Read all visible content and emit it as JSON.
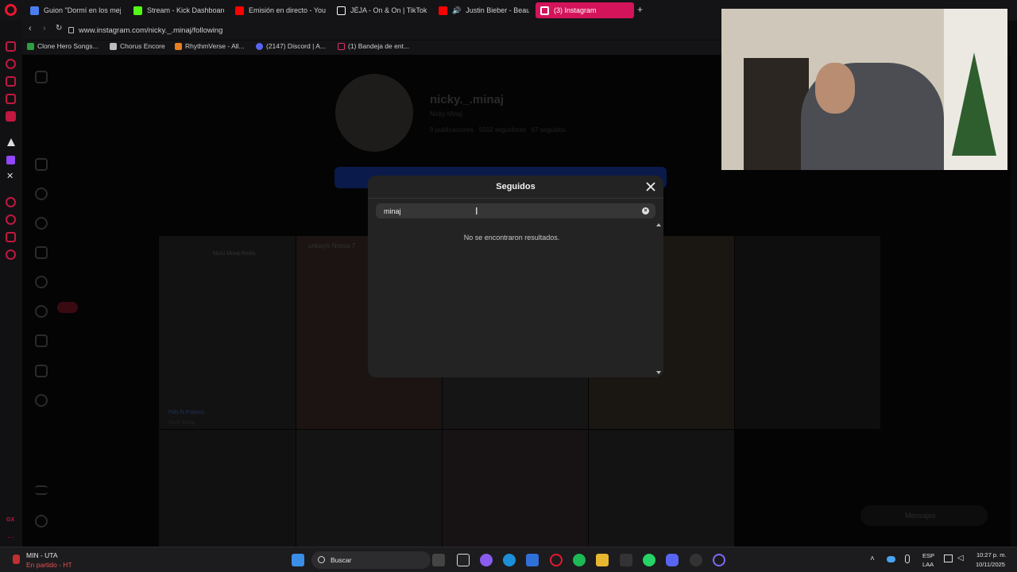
{
  "browser": {
    "tabs": [
      {
        "label": "Guion \"Dormí en los mejo",
        "color": "#4a7ef0"
      },
      {
        "label": "Stream - Kick Dashboard",
        "color": "#53fc18"
      },
      {
        "label": "Emisión en directo - YouT",
        "color": "#ff0000"
      },
      {
        "label": "JÉJA - On & On | TikTok",
        "color": "#ffffff"
      },
      {
        "label": "Justin Bieber - Beaut",
        "color": "#ff0000"
      },
      {
        "label": "(3) Instagram",
        "color": "#e1306c"
      }
    ],
    "new_tab": "+",
    "url": "www.instagram.com/nicky._.minaj/following",
    "bookmarks": [
      {
        "label": "Clone Hero Songs...",
        "color": "#2e9e3e"
      },
      {
        "label": "Chorus Encore",
        "color": "#bbbbbb"
      },
      {
        "label": "RhythmVerse - All...",
        "color": "#e67e22"
      },
      {
        "label": "(2147) Discord | A...",
        "color": "#5865f2"
      },
      {
        "label": "(1) Bandeja de ent...",
        "color": "#e1306c"
      }
    ]
  },
  "profile": {
    "username": "nicky._.minaj",
    "name": "Nicky Minaj",
    "stats": "9 publicaciones   5502 seguidores   67 seguidos",
    "highlight_title": "Pills N Potions",
    "highlight_sub": "Nicki Minaj",
    "post_user": "unkayni Nossa 7",
    "post_title": "Nicki Minaj Redis",
    "messages_label": "Mensajes"
  },
  "modal": {
    "title": "Seguidos",
    "search_value": "minaj",
    "clear_icon": "×",
    "empty_text": "No se encontraron resultados."
  },
  "taskbar": {
    "game_title": "MIN - UTA",
    "game_status": "En partido - HT",
    "search_label": "Buscar",
    "lang": "ESP",
    "region": "LAA",
    "time": "10:27 p. m.",
    "date": "10/11/2025"
  },
  "colors": {
    "accent": "#d4145a",
    "opera_red": "#c0183f"
  }
}
